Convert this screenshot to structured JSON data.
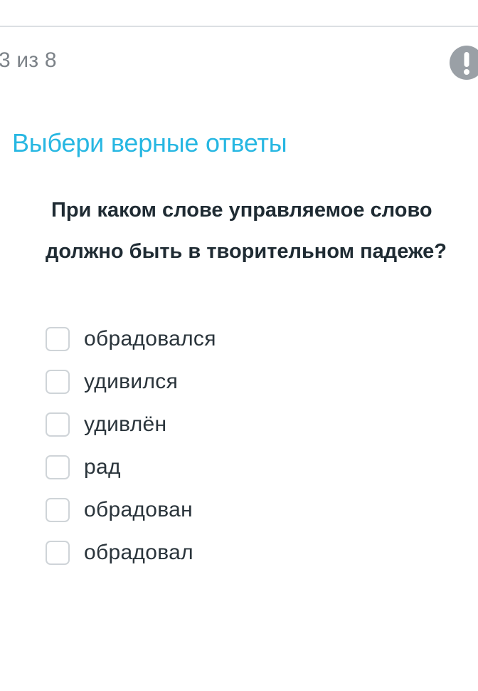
{
  "header": {
    "progress_text": "3 из 8",
    "report_icon": "exclamation-icon"
  },
  "task": {
    "title": "Выбери верные ответы",
    "question": "При каком слове управляемое слово должно быть в творительном падеже?"
  },
  "options": [
    {
      "label": "обрадовался",
      "checked": false
    },
    {
      "label": "удивился",
      "checked": false
    },
    {
      "label": "удивлён",
      "checked": false
    },
    {
      "label": "рад",
      "checked": false
    },
    {
      "label": "обрадован",
      "checked": false
    },
    {
      "label": "обрадовал",
      "checked": false
    }
  ],
  "colors": {
    "title": "#27b7e2",
    "question_text": "#1f2b33",
    "progress_text": "#7c8288",
    "report_button": "#9aa0a6",
    "checkbox_border": "#cfd4d8",
    "divider": "#dcdfe3"
  }
}
